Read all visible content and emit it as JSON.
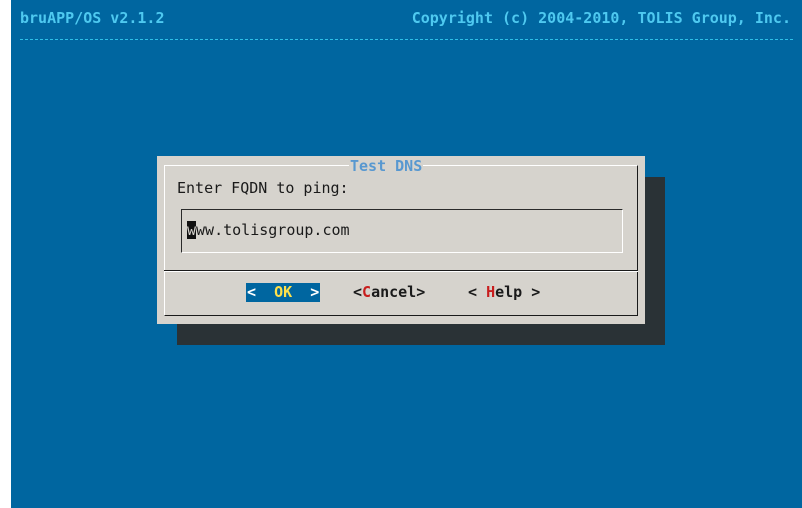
{
  "header": {
    "title": "bruAPP/OS v2.1.2",
    "copyright": "Copyright (c) 2004-2010, TOLIS Group, Inc."
  },
  "dialog": {
    "title": "Test DNS",
    "prompt": "Enter FQDN to ping:",
    "input": {
      "cursor_char": "w",
      "value_rest": "ww.tolisgroup.com",
      "full_value": "www.tolisgroup.com"
    },
    "buttons": {
      "ok": {
        "left": "< ",
        "hotkey": "O",
        "rest": "K",
        "right": " >"
      },
      "cancel": {
        "left": "<",
        "hotkey": "C",
        "rest": "ancel",
        "right": ">"
      },
      "help": {
        "left": "< ",
        "hotkey": "H",
        "rest": "elp",
        "right": " >"
      }
    }
  },
  "colors": {
    "background": "#0066a0",
    "header_text": "#4ec9f0",
    "dialog_bg": "#d6d3cd",
    "dialog_title": "#5898d0",
    "hotkey_red": "#c81e1e",
    "hotkey_yellow": "#ffe14a",
    "shadow": "#2a3236"
  }
}
